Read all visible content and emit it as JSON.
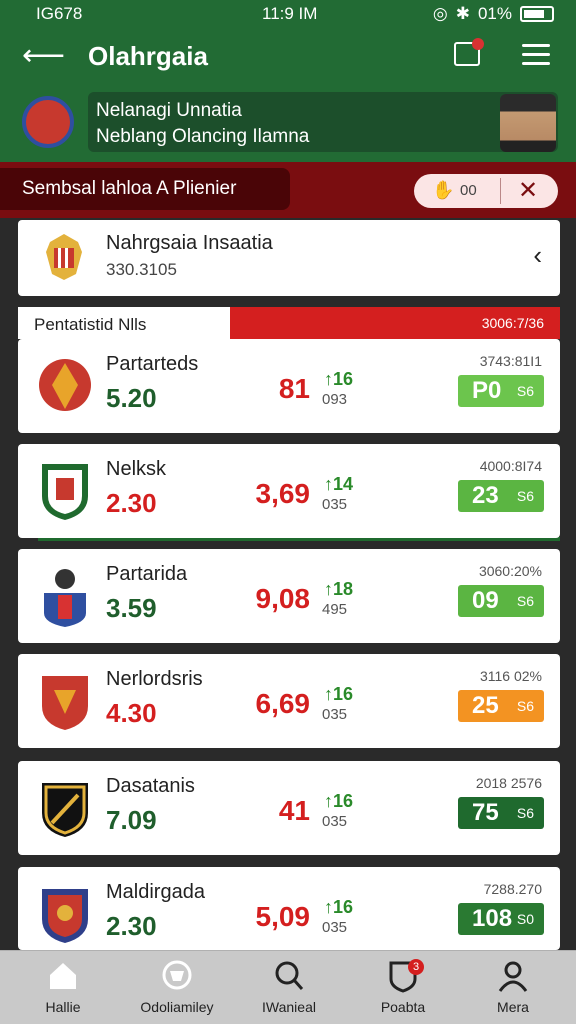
{
  "status_bar": {
    "left_time": "IG678",
    "center_time": "11:9 IM",
    "battery": "01%"
  },
  "app_bar": {
    "title": "Olahrgaia"
  },
  "banner": {
    "line1": "Nelanagi Unnatia",
    "line2": "Neblang Olancing Ilamna"
  },
  "red_bar": {
    "label": "Sembsal lahloa A Plienier",
    "pill_text": "00"
  },
  "header_card": {
    "name": "Nahrgsaia Insaatia",
    "sub": "330.3105"
  },
  "grid_head": {
    "title": "Pentatistid Nlls",
    "right": "3006:7/36"
  },
  "rows": [
    {
      "team": "Partarteds",
      "value": "5.20",
      "value_color": "green",
      "odds": "81",
      "delta": "16",
      "sub": "093",
      "code": "3743:81I1",
      "badge": "P0",
      "badge_unit": "S6",
      "badge_color": "#6cc54d"
    },
    {
      "team": "Nelksk",
      "value": "2.30",
      "value_color": "red",
      "odds": "3,69",
      "delta": "14",
      "sub": "035",
      "code": "4000:8I74",
      "badge": "23",
      "badge_unit": "S6",
      "badge_color": "#5bb542"
    },
    {
      "team": "Partarida",
      "value": "3.59",
      "value_color": "green",
      "odds": "9,08",
      "delta": "18",
      "sub": "495",
      "code": "3060:20%",
      "badge": "09",
      "badge_unit": "S6",
      "badge_color": "#5bb542"
    },
    {
      "team": "Nerlordsris",
      "value": "4.30",
      "value_color": "red",
      "odds": "6,69",
      "delta": "16",
      "sub": "035",
      "code": "3116 02%",
      "badge": "25",
      "badge_unit": "S6",
      "badge_color": "#f39322"
    },
    {
      "team": "Dasatanis",
      "value": "7.09",
      "value_color": "green",
      "odds": "41",
      "delta": "16",
      "sub": "035",
      "code": "2018 2576",
      "badge": "75",
      "badge_unit": "S6",
      "badge_color": "#1f6a2e"
    },
    {
      "team": "Maldirgada",
      "value": "2.30",
      "value_color": "green",
      "odds": "5,09",
      "delta": "16",
      "sub": "035",
      "code": "7288.270",
      "badge": "108",
      "badge_unit": "S0",
      "badge_color": "#2a7a32"
    }
  ],
  "bottom_nav": [
    {
      "label": "Hallie",
      "icon": "home-icon"
    },
    {
      "label": "Odoliamiley",
      "icon": "trophy-icon"
    },
    {
      "label": "IWanieal",
      "icon": "search-icon"
    },
    {
      "label": "Poabta",
      "icon": "shield-icon",
      "badge": "3"
    },
    {
      "label": "Mera",
      "icon": "person-icon"
    }
  ],
  "colors": {
    "primary_green": "#226b34",
    "dark_red": "#7a0d10",
    "accent_red": "#d41f1f"
  }
}
